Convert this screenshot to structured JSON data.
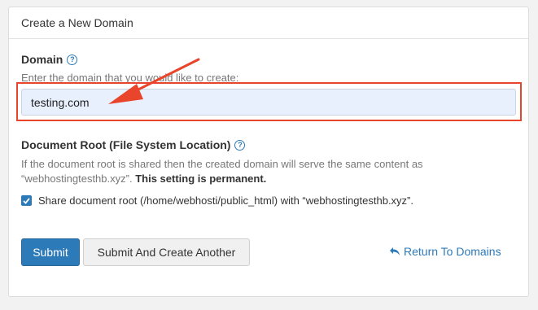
{
  "panel": {
    "title": "Create a New Domain"
  },
  "domain": {
    "label": "Domain",
    "hint": "Enter the domain that you would like to create:",
    "value": "testing.com"
  },
  "document_root": {
    "label": "Document Root (File System Location)",
    "description": "If the document root is shared then the created domain will serve the same content as “webhostingtesthb.xyz”.",
    "warning": "This setting is permanent.",
    "share_label": "Share document root (/home/webhosti/public_html) with “webhostingtesthb.xyz”.",
    "share_checked": true
  },
  "actions": {
    "submit_label": "Submit",
    "submit_another_label": "Submit And Create Another",
    "return_label": "Return To Domains"
  },
  "colors": {
    "accent": "#2d7ab9",
    "annotation": "#e8452c",
    "input_background": "#e8f0fe"
  },
  "icons": {
    "help": "question-circle-icon",
    "checkbox": "checkmark-icon",
    "return": "return-arrow-icon",
    "annotation": "red-pointer-arrow"
  }
}
